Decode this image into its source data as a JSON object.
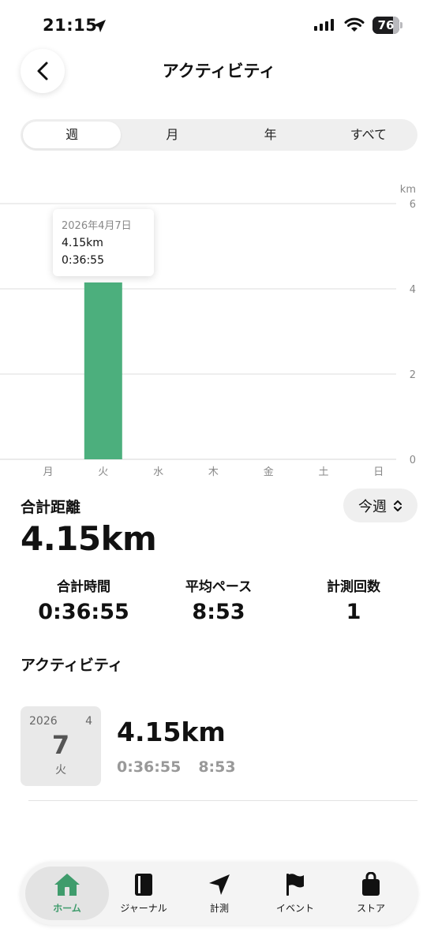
{
  "status_bar": {
    "time": "21:15",
    "battery": "76",
    "battery_level": 76
  },
  "header": {
    "title": "アクティビティ"
  },
  "segments": [
    "週",
    "月",
    "年",
    "すべて"
  ],
  "selected_segment": "週",
  "chart_data": {
    "type": "bar",
    "categories": [
      "月",
      "火",
      "水",
      "木",
      "金",
      "土",
      "日"
    ],
    "values": [
      0,
      4.15,
      0,
      0,
      0,
      0,
      0
    ],
    "ylabel": "km",
    "ylim": [
      0,
      6
    ],
    "yticks": [
      "0",
      "2",
      "4",
      "6"
    ],
    "grid": true,
    "bar_color": "#4caf7d",
    "tooltip": {
      "date": "2026年4月7日",
      "distance": "4.15km",
      "time": "0:36:55"
    }
  },
  "summary": {
    "distance_label": "合計距離",
    "distance_value": "4.15km",
    "period_button": "今週",
    "stats": [
      {
        "label": "合計時間",
        "value": "0:36:55"
      },
      {
        "label": "平均ペース",
        "value": "8:53"
      },
      {
        "label": "計測回数",
        "value": "1"
      }
    ]
  },
  "activity_section": {
    "title": "アクティビティ",
    "items": [
      {
        "year": "2026",
        "month": "4",
        "day": "7",
        "weekday": "火",
        "distance": "4.15km",
        "time": "0:36:55",
        "pace": "8:53"
      }
    ]
  },
  "tabbar": {
    "items": [
      {
        "label": "ホーム",
        "icon": "home-icon"
      },
      {
        "label": "ジャーナル",
        "icon": "journal-icon"
      },
      {
        "label": "計測",
        "icon": "navigation-arrow-icon"
      },
      {
        "label": "イベント",
        "icon": "flag-icon"
      },
      {
        "label": "ストア",
        "icon": "shopping-bag-icon"
      }
    ],
    "active": "ホーム",
    "accent": "#3f9c6c"
  }
}
